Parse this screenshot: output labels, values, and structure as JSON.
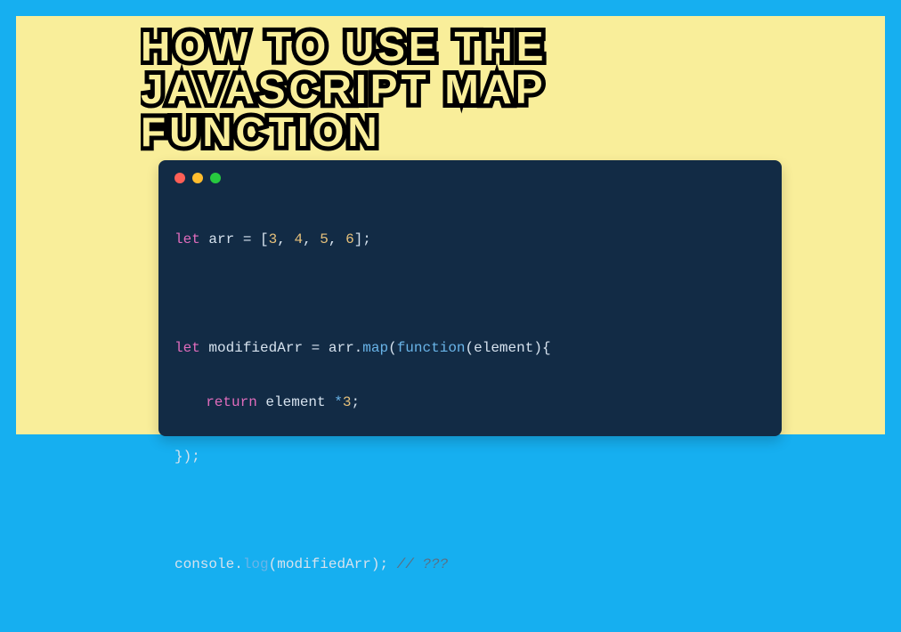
{
  "title": "HOW TO USE THE JAVASCRIPT MAP FUNCTION",
  "colors": {
    "outer": "#16AFF0",
    "inner": "#F9EE9A",
    "code_bg": "#122B45",
    "title_fill": "#F9EE9A",
    "title_stroke": "#000000"
  },
  "code": {
    "line1": {
      "kw": "let",
      "id": "arr",
      "eq": " = ",
      "br_o": "[",
      "n1": "3",
      "c": ", ",
      "n2": "4",
      "n3": "5",
      "n4": "6",
      "br_c": "];"
    },
    "line2": {
      "kw": "let",
      "id": "modifiedArr",
      "eq": " = ",
      "obj": "arr",
      "dot": ".",
      "method": "map",
      "p_o": "(",
      "fnkw": "function",
      "p2_o": "(",
      "arg": "element",
      "p2_c": "){"
    },
    "line3": {
      "kw": "return",
      "id": "element",
      "op": " *",
      "num": "3",
      "end": ";"
    },
    "line4": {
      "text": "});"
    },
    "line5": {
      "obj": "console",
      "dot": ".",
      "method": "log",
      "p_o": "(",
      "arg": "modifiedArr",
      "p_c": ");",
      "cmt": " // ???"
    }
  }
}
